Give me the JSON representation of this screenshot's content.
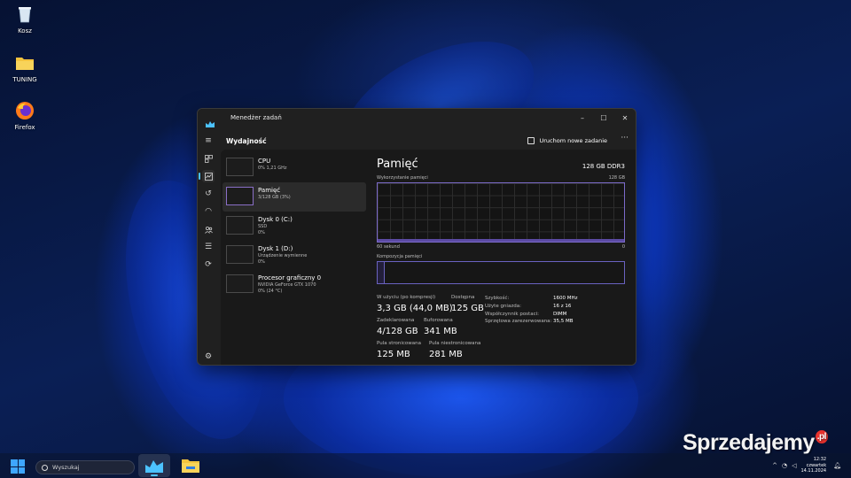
{
  "desktop": {
    "icons": [
      {
        "label": "Kosz",
        "icon": "recycle-bin-icon"
      },
      {
        "label": "TUNING",
        "icon": "folder-icon"
      },
      {
        "label": "Firefox",
        "icon": "firefox-icon"
      }
    ]
  },
  "window": {
    "title": "Menedżer zadań",
    "buttons": {
      "minimize": "–",
      "maximize": "☐",
      "close": "✕"
    }
  },
  "header": {
    "title": "Wydajność",
    "run_task": "Uruchom nowe zadanie",
    "more": "···"
  },
  "perf_list": [
    {
      "name": "CPU",
      "sub1": "0% 1,21 GHz",
      "sub2": ""
    },
    {
      "name": "Pamięć",
      "sub1": "3/128 GB (3%)",
      "sub2": ""
    },
    {
      "name": "Dysk 0 (C:)",
      "sub1": "SSD",
      "sub2": "0%"
    },
    {
      "name": "Dysk 1 (D:)",
      "sub1": "Urządzenie wymienne",
      "sub2": "0%"
    },
    {
      "name": "Procesor graficzny 0",
      "sub1": "NVIDIA GeForce GTX 1070",
      "sub2": "0% (24 °C)"
    }
  ],
  "memory": {
    "title": "Pamięć",
    "spec": "128 GB DDR3",
    "usage_label": "Wykorzystanie pamięci",
    "usage_max": "128 GB",
    "time_label": "60 sekund",
    "time_min": "0",
    "composition_label": "Kompozycja pamięci",
    "composition_used_fraction": 0.03,
    "stats": {
      "in_use_label": "W użyciu (po kompresji)",
      "in_use_value": "3,3 GB (44,0 MB)",
      "available_label": "Dostępna",
      "available_value": "125 GB",
      "committed_label": "Zadeklarowana",
      "committed_value": "4/128 GB",
      "cached_label": "Buforowana",
      "cached_value": "341 MB",
      "paged_label": "Pula stronicowana",
      "paged_value": "125 MB",
      "nonpaged_label": "Pula niestronicowana",
      "nonpaged_value": "281 MB"
    },
    "details": [
      {
        "key": "Szybkość:",
        "value": "1600 MHz"
      },
      {
        "key": "Użyte gniazda:",
        "value": "16 z 16"
      },
      {
        "key": "Współczynnik postaci:",
        "value": "DIMM"
      },
      {
        "key": "Sprzętowa zarezerwowana:",
        "value": "35,5 MB"
      }
    ]
  },
  "taskbar": {
    "search_placeholder": "Wyszukaj",
    "tray_chevron": "^",
    "time": "12:32",
    "day": "czwartek",
    "date": "14.11.2024"
  },
  "watermark": {
    "brand": "Sprzedajemy",
    "tld": ".pl"
  },
  "colors": {
    "accent": "#4cc2ff",
    "graph_border": "#7b6ac9"
  }
}
